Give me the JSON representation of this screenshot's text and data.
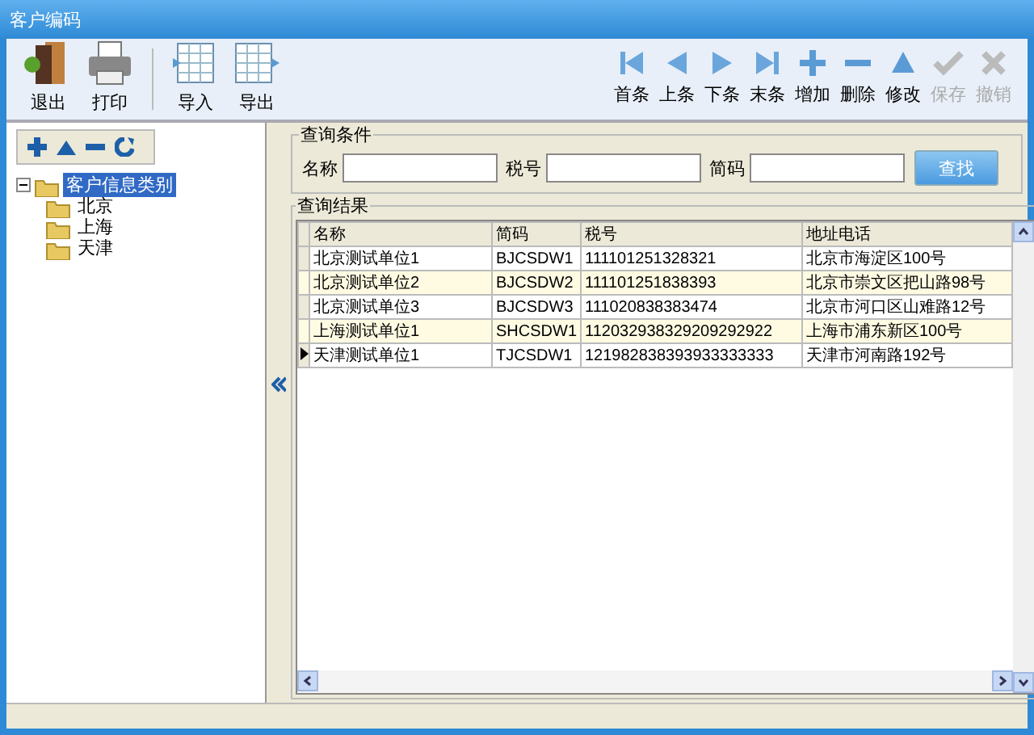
{
  "window": {
    "title": "客户编码"
  },
  "toolbar": {
    "left": [
      {
        "label": "退出",
        "kind": "exit",
        "disabled": false
      },
      {
        "label": "打印",
        "kind": "print",
        "disabled": false
      },
      {
        "label": "导入",
        "kind": "import",
        "disabled": false
      },
      {
        "label": "导出",
        "kind": "export",
        "disabled": false
      }
    ],
    "right": [
      {
        "label": "首条",
        "kind": "first",
        "disabled": false
      },
      {
        "label": "上条",
        "kind": "prev",
        "disabled": false
      },
      {
        "label": "下条",
        "kind": "next",
        "disabled": false
      },
      {
        "label": "末条",
        "kind": "last",
        "disabled": false
      },
      {
        "label": "增加",
        "kind": "add",
        "disabled": false
      },
      {
        "label": "删除",
        "kind": "delete",
        "disabled": false
      },
      {
        "label": "修改",
        "kind": "edit",
        "disabled": false
      },
      {
        "label": "保存",
        "kind": "save",
        "disabled": true
      },
      {
        "label": "撤销",
        "kind": "cancel",
        "disabled": true
      }
    ]
  },
  "tree": {
    "label": "客户信息类别",
    "selected": true,
    "expanded": true,
    "children": [
      {
        "label": "北京",
        "selected": false
      },
      {
        "label": "上海",
        "selected": false
      },
      {
        "label": "天津",
        "selected": false
      }
    ]
  },
  "query": {
    "title": "查询条件",
    "fields": [
      {
        "label": "名称"
      },
      {
        "label": "税号"
      },
      {
        "label": "简码"
      }
    ],
    "button": "查找"
  },
  "results": {
    "title": "查询结果",
    "columns": [
      "名称",
      "简码",
      "税号",
      "地址电话"
    ],
    "rows": [
      {
        "cells": [
          "北京测试单位1",
          "BJCSDW1",
          "111101251328321",
          "北京市海淀区100号"
        ],
        "selected": false
      },
      {
        "cells": [
          "北京测试单位2",
          "BJCSDW2",
          "111101251838393",
          "北京市崇文区把山路98号"
        ],
        "selected": false
      },
      {
        "cells": [
          "北京测试单位3",
          "BJCSDW3",
          "111020838383474",
          "北京市河口区山难路12号"
        ],
        "selected": false
      },
      {
        "cells": [
          "上海测试单位1",
          "SHCSDW1",
          "112032938329209292922",
          "上海市浦东新区100号"
        ],
        "selected": false
      },
      {
        "cells": [
          "天津测试单位1",
          "TJCSDW1",
          "121982838393933333333",
          "天津市河南路192号"
        ],
        "selected": true
      }
    ]
  }
}
